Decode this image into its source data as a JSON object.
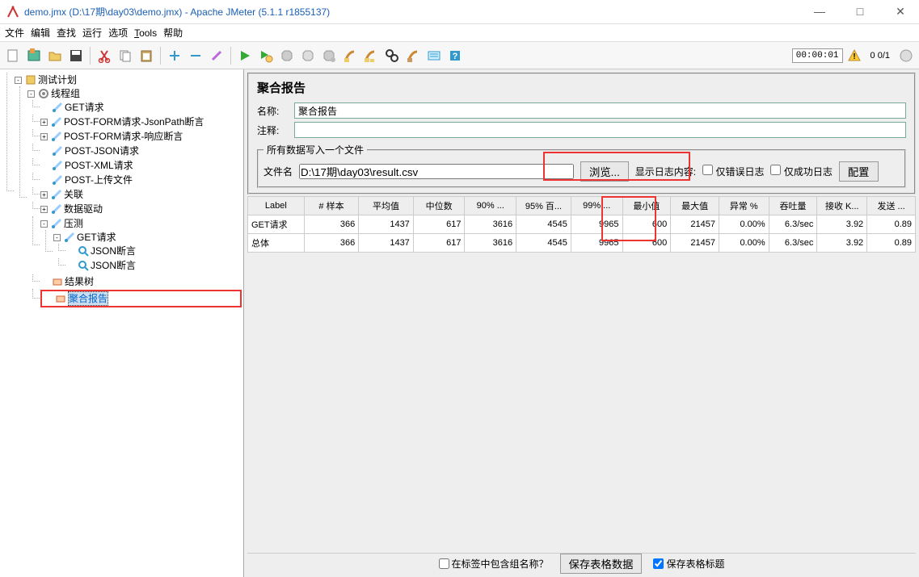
{
  "window": {
    "title": "demo.jmx (D:\\17期\\day03\\demo.jmx) - Apache JMeter (5.1.1 r1855137)",
    "minimize": "—",
    "maximize": "□",
    "close": "✕"
  },
  "menu": [
    "文件",
    "编辑",
    "查找",
    "运行",
    "选项",
    "Tools",
    "帮助"
  ],
  "status": {
    "time": "00:00:01",
    "counter": "0  0/1"
  },
  "tree": {
    "root": "测试计划",
    "tg": "线程组",
    "i1": "GET请求",
    "i2": "POST-FORM请求-JsonPath断言",
    "i3": "POST-FORM请求-响应断言",
    "i4": "POST-JSON请求",
    "i5": "POST-XML请求",
    "i6": "POST-上传文件",
    "i7": "关联",
    "i8": "数据驱动",
    "i9": "压测",
    "i9a": "GET请求",
    "i9b": "JSON断言",
    "i9c": "JSON断言",
    "i10": "结果树",
    "i11": "聚合报告"
  },
  "panel": {
    "title": "聚合报告",
    "name_label": "名称:",
    "name_value": "聚合报告",
    "comment_label": "注释:",
    "fieldset": "所有数据写入一个文件",
    "file_label": "文件名",
    "file_value": "D:\\17期\\day03\\result.csv",
    "browse": "浏览...",
    "show_label": "显示日志内容:",
    "only_err": "仅错误日志",
    "only_ok": "仅成功日志",
    "config": "配置"
  },
  "table": {
    "headers": [
      "Label",
      "# 样本",
      "平均值",
      "中位数",
      "90% ...",
      "95% 百...",
      "99% ...",
      "最小值",
      "最大值",
      "异常 %",
      "吞吐量",
      "接收 K...",
      "发送 ..."
    ],
    "rows": [
      [
        "GET请求",
        "366",
        "1437",
        "617",
        "3616",
        "4545",
        "9965",
        "600",
        "21457",
        "0.00%",
        "6.3/sec",
        "3.92",
        "0.89"
      ],
      [
        "总体",
        "366",
        "1437",
        "617",
        "3616",
        "4545",
        "9965",
        "600",
        "21457",
        "0.00%",
        "6.3/sec",
        "3.92",
        "0.89"
      ]
    ]
  },
  "footer": {
    "group": "在标签中包含组名称？",
    "save_data": "保存表格数据",
    "save_header": "保存表格标题"
  }
}
